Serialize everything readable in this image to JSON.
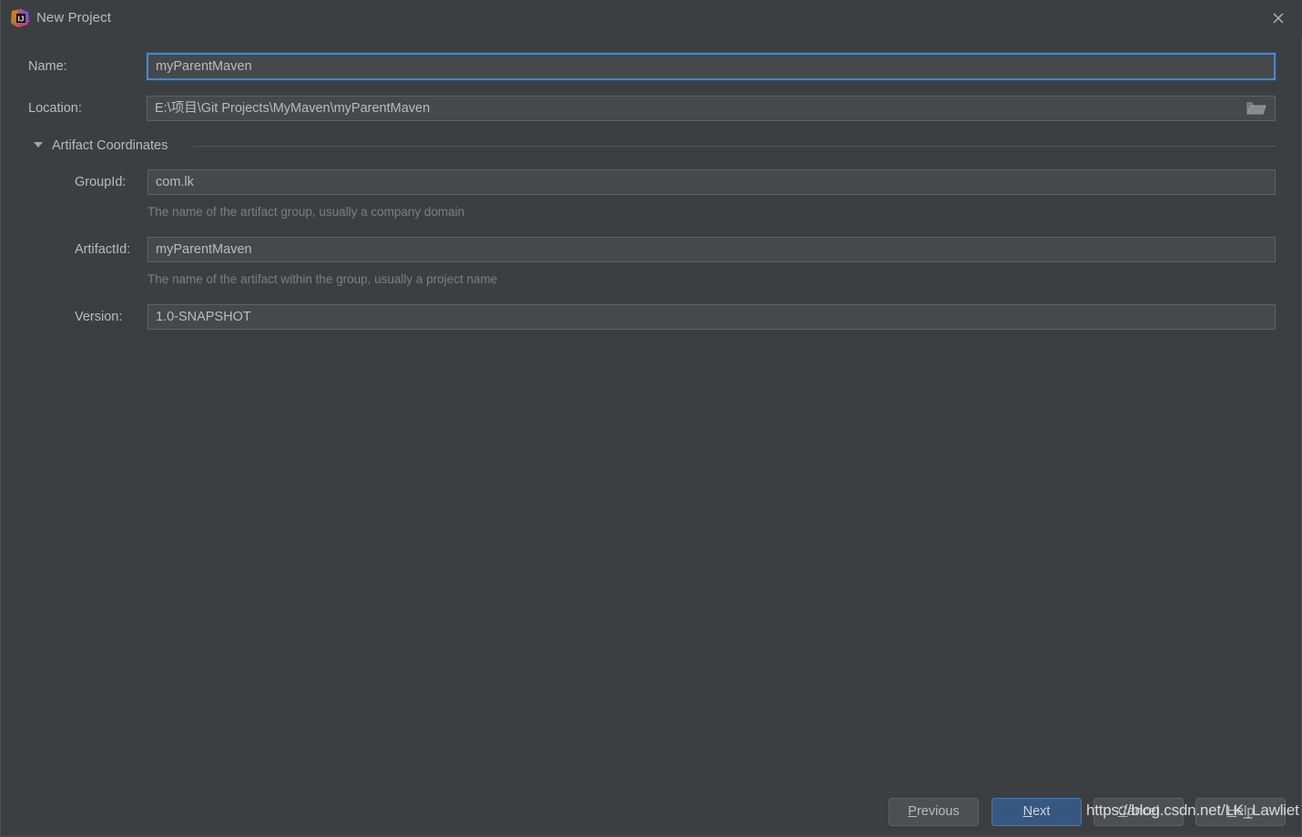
{
  "window": {
    "title": "New Project",
    "app_icon": "intellij-idea-icon",
    "close_icon": "close-icon",
    "background_color": "#3c3f41",
    "accent_color": "#365880",
    "focus_border_color": "#4b88c7"
  },
  "form": {
    "name": {
      "label": "Name:",
      "value": "myParentMaven",
      "placeholder": "",
      "focused": true
    },
    "location": {
      "label": "Location:",
      "value": "E:\\项目\\Git Projects\\MyMaven\\myParentMaven",
      "placeholder": "",
      "browse_icon": "folder-icon"
    }
  },
  "artifact_section": {
    "title": "Artifact Coordinates",
    "expanded": true,
    "collapse_icon": "chevron-down-icon",
    "fields": [
      {
        "label": "GroupId:",
        "value": "com.lk",
        "hint": "The name of the artifact group, usually a company domain"
      },
      {
        "label": "ArtifactId:",
        "value": "myParentMaven",
        "hint": "The name of the artifact within the group, usually a project name"
      },
      {
        "label": "Version:",
        "value": "1.0-SNAPSHOT",
        "hint": ""
      }
    ]
  },
  "buttons": {
    "previous": {
      "pre": "",
      "mnemonic": "P",
      "post": "revious",
      "primary": false
    },
    "next": {
      "pre": "",
      "mnemonic": "N",
      "post": "ext",
      "primary": true
    },
    "cancel": {
      "pre": "",
      "mnemonic": "C",
      "post": "ancel",
      "primary": false
    },
    "help": {
      "pre": "",
      "mnemonic": "H",
      "post": "elp",
      "primary": false
    }
  },
  "watermark": {
    "text": "https://blog.csdn.net/LK_Lawliet"
  }
}
